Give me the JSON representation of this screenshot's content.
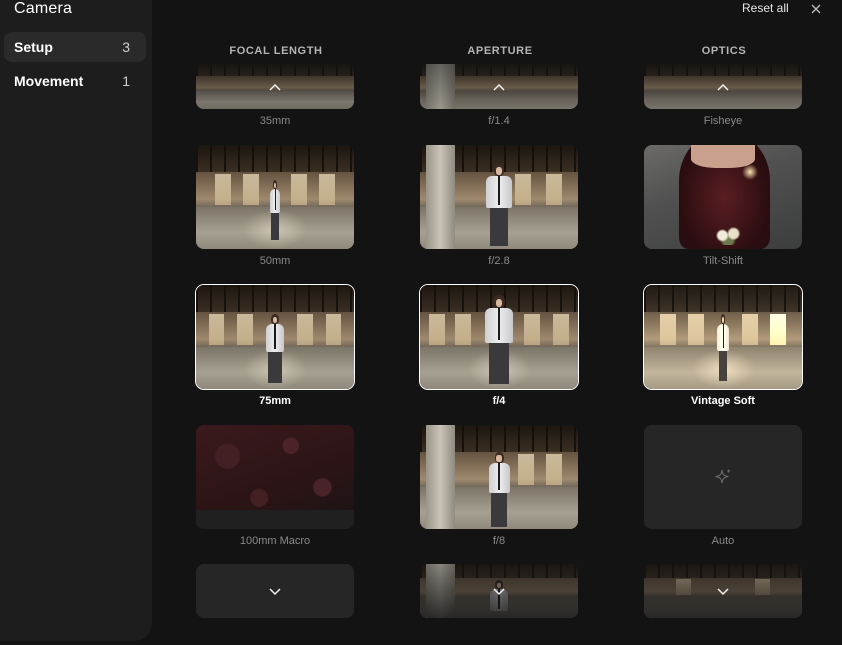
{
  "sidebar": {
    "title": "Camera",
    "items": [
      {
        "label": "Setup",
        "count": "3"
      },
      {
        "label": "Movement",
        "count": "1"
      }
    ]
  },
  "header": {
    "reset_label": "Reset all",
    "close_icon": "close-icon"
  },
  "columns": [
    {
      "heading": "FOCAL LENGTH"
    },
    {
      "heading": "APERTURE"
    },
    {
      "heading": "OPTICS"
    }
  ],
  "focal": [
    "35mm",
    "50mm",
    "75mm",
    "100mm Macro"
  ],
  "aperture": [
    "f/1.4",
    "f/2.8",
    "f/4",
    "f/8"
  ],
  "optics": [
    "Fisheye",
    "Tilt-Shift",
    "Vintage Soft",
    "Auto"
  ],
  "selected": {
    "focal": "75mm",
    "aperture": "f/4",
    "optics": "Vintage Soft"
  },
  "icons": {
    "scroll_up": "chevron-up-icon",
    "scroll_down": "chevron-down-icon",
    "auto": "sparkle-icon"
  },
  "colors": {
    "background": "#131313",
    "sidebar": "#1d1d1d",
    "selected_outline": "#ffffff",
    "muted_label": "#8a8a8a"
  }
}
